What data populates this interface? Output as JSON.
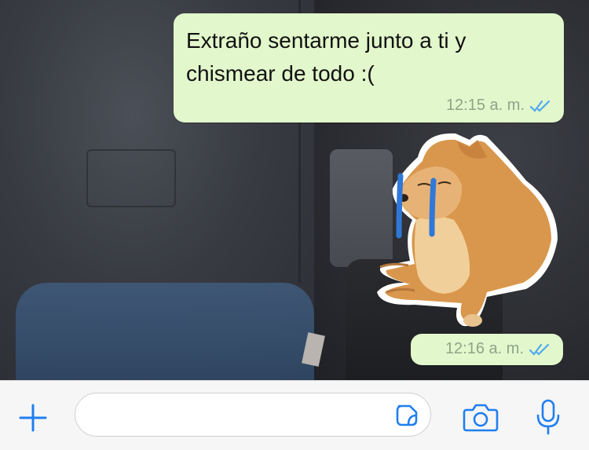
{
  "messages": [
    {
      "text": "Extraño sentarme junto a ti y chismear de todo :(",
      "time": "12:15 a. m.",
      "read": true
    },
    {
      "type": "sticker",
      "sticker": "crying-cheems-dog-sticker",
      "time": "12:16 a. m.",
      "read": true
    }
  ],
  "input_bar": {
    "placeholder": "",
    "icons": [
      "plus-icon",
      "sticker-icon",
      "camera-icon",
      "microphone-icon"
    ]
  },
  "colors": {
    "outgoing_bubble": "#e2f7cb",
    "accent": "#1f7ff0",
    "read_ticks": "#4fa9f0",
    "timestamp": "#8fa48a",
    "input_bar_bg": "#f6f6f6"
  }
}
